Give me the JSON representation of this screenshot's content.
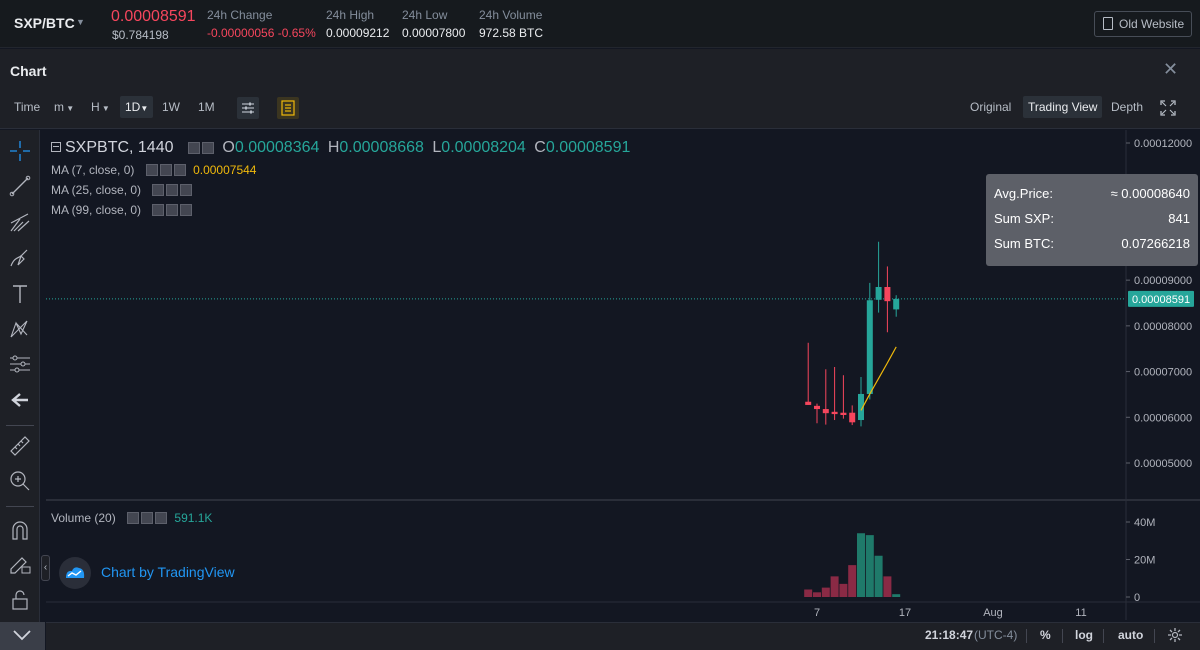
{
  "ticker": {
    "symbol": "SXP/BTC",
    "last_price": "0.00008591",
    "usd_price": "$0.784198",
    "change_label": "24h Change",
    "change_value": "-0.00000056 -0.65%",
    "high_label": "24h High",
    "high_value": "0.00009212",
    "low_label": "24h Low",
    "low_value": "0.00007800",
    "volume_label": "24h Volume",
    "volume_value": "972.58 BTC",
    "old_site_label": "Old Website"
  },
  "panel": {
    "title": "Chart"
  },
  "toolbar": {
    "time_label": "Time",
    "intervals": [
      "m",
      "H",
      "1D",
      "1W",
      "1M"
    ],
    "active_interval": "1D",
    "views": [
      "Original",
      "Trading View",
      "Depth"
    ],
    "active_view": "Trading View"
  },
  "legend": {
    "symbol_interval": "SXPBTC, 1440",
    "o_key": "O",
    "o_val": "0.00008364",
    "h_key": "H",
    "h_val": "0.00008668",
    "l_key": "L",
    "l_val": "0.00008204",
    "c_key": "C",
    "c_val": "0.00008591",
    "ma7": "MA (7, close, 0)",
    "ma7_val": "0.00007544",
    "ma25": "MA (25, close, 0)",
    "ma99": "MA (99, close, 0)",
    "volume": "Volume (20)",
    "volume_val": "591.1K"
  },
  "tooltip": {
    "avg_label": "Avg.Price:",
    "avg_value": "≈ 0.00008640",
    "sum_sxp_label": "Sum SXP:",
    "sum_sxp_value": "841",
    "sum_btc_label": "Sum BTC:",
    "sum_btc_value": "0.07266218"
  },
  "watermark": "Chart by TradingView",
  "status": {
    "time": "21:18:47",
    "timezone": "(UTC-4)",
    "percent": "%",
    "log": "log",
    "auto": "auto"
  },
  "colors": {
    "up": "#26a69a",
    "down": "#f6465d",
    "ma7": "#f0b90b",
    "last_price_line": "#26a69a"
  },
  "chart_data": {
    "type": "candlestick",
    "price_axis_ticks": [
      "0.00012000",
      "0.00009000",
      "0.00008000",
      "0.00007000",
      "0.00006000",
      "0.00005000"
    ],
    "price_axis_values": [
      0.00012,
      9e-05,
      8e-05,
      7e-05,
      6e-05,
      5e-05
    ],
    "last_price_label": "0.00008591",
    "last_price": 8.591e-05,
    "volume_axis_ticks": [
      "40M",
      "20M",
      "0"
    ],
    "volume_axis_values": [
      40,
      20,
      0
    ],
    "time_axis_ticks": [
      "7",
      "17",
      "Aug",
      "11"
    ],
    "time_axis_day_index": [
      7,
      17,
      27,
      37
    ],
    "candles": [
      {
        "day": 6,
        "o": 6.34e-05,
        "h": 7.63e-05,
        "l": 6.27e-05,
        "c": 6.27e-05
      },
      {
        "day": 7,
        "o": 6.25e-05,
        "h": 6.3e-05,
        "l": 5.87e-05,
        "c": 6.18e-05
      },
      {
        "day": 8,
        "o": 6.18e-05,
        "h": 7.05e-05,
        "l": 5.84e-05,
        "c": 6.09e-05
      },
      {
        "day": 9,
        "o": 6.12e-05,
        "h": 7.1e-05,
        "l": 5.94e-05,
        "c": 6.07e-05
      },
      {
        "day": 10,
        "o": 6.1e-05,
        "h": 6.92e-05,
        "l": 5.97e-05,
        "c": 6.05e-05
      },
      {
        "day": 11,
        "o": 6.1e-05,
        "h": 6.26e-05,
        "l": 5.83e-05,
        "c": 5.89e-05
      },
      {
        "day": 12,
        "o": 5.94e-05,
        "h": 6.88e-05,
        "l": 5.8e-05,
        "c": 6.51e-05
      },
      {
        "day": 13,
        "o": 6.51e-05,
        "h": 8.94e-05,
        "l": 6.39e-05,
        "c": 8.56e-05
      },
      {
        "day": 14,
        "o": 8.57e-05,
        "h": 9.84e-05,
        "l": 8.29e-05,
        "c": 8.85e-05
      },
      {
        "day": 15,
        "o": 8.85e-05,
        "h": 9.3e-05,
        "l": 7.86e-05,
        "c": 8.54e-05
      },
      {
        "day": 16,
        "o": 8.36e-05,
        "h": 8.67e-05,
        "l": 8.2e-05,
        "c": 8.59e-05
      }
    ],
    "ma7": [
      {
        "day": 12,
        "v": 6.15e-05
      },
      {
        "day": 13,
        "v": 6.51e-05
      },
      {
        "day": 14,
        "v": 6.85e-05
      },
      {
        "day": 15,
        "v": 7.19e-05
      },
      {
        "day": 16,
        "v": 7.54e-05
      }
    ],
    "volume_millions": [
      {
        "day": 6,
        "v": 4,
        "up": false
      },
      {
        "day": 7,
        "v": 2.5,
        "up": false
      },
      {
        "day": 8,
        "v": 5,
        "up": false
      },
      {
        "day": 9,
        "v": 11,
        "up": false
      },
      {
        "day": 10,
        "v": 7,
        "up": false
      },
      {
        "day": 11,
        "v": 17,
        "up": false
      },
      {
        "day": 12,
        "v": 34,
        "up": true
      },
      {
        "day": 13,
        "v": 33,
        "up": true
      },
      {
        "day": 14,
        "v": 22,
        "up": true
      },
      {
        "day": 15,
        "v": 11,
        "up": false
      },
      {
        "day": 16,
        "v": 1.5,
        "up": true
      }
    ]
  }
}
